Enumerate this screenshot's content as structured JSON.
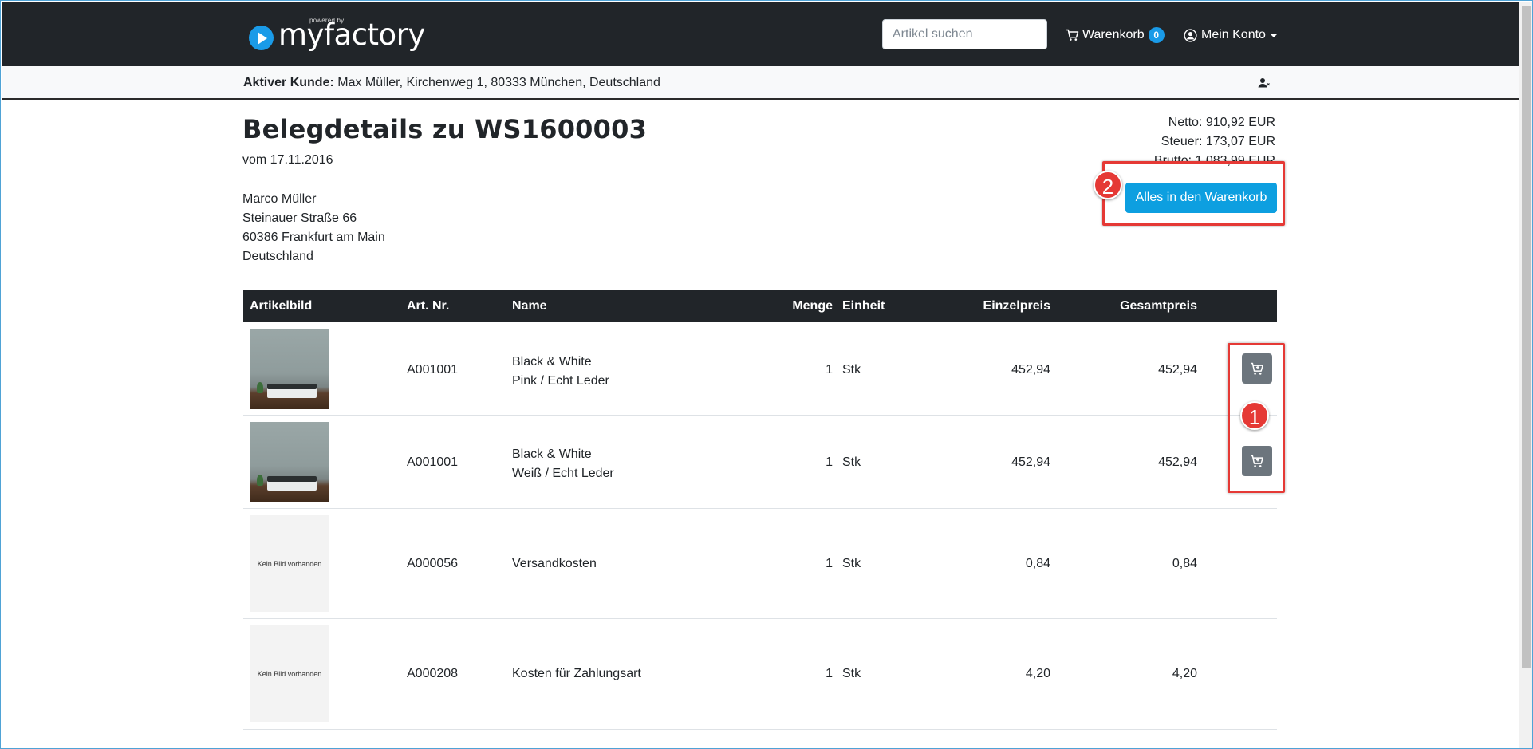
{
  "navbar": {
    "logo_powered": "powered by",
    "logo_text": "myfactory",
    "search_placeholder": "Artikel suchen",
    "cart_label": "Warenkorb",
    "cart_count": "0",
    "account_label": "Mein Konto"
  },
  "customer_bar": {
    "label": "Aktiver Kunde:",
    "value": "Max Müller, Kirchenweg 1, 80333 München, Deutschland"
  },
  "document": {
    "title": "Belegdetails zu WS1600003",
    "date": "vom 17.11.2016",
    "address": [
      "Marco Müller",
      "Steinauer Straße 66",
      "60386 Frankfurt am Main",
      "Deutschland"
    ],
    "netto": "Netto: 910,92 EUR",
    "steuer": "Steuer: 173,07 EUR",
    "brutto": "Brutto: 1.083,99 EUR",
    "add_all_label": "Alles in den Warenkorb"
  },
  "annotations": {
    "marker_1": "1",
    "marker_2": "2"
  },
  "table": {
    "headers": {
      "image": "Artikelbild",
      "art_nr": "Art. Nr.",
      "name": "Name",
      "qty": "Menge",
      "unit": "Einheit",
      "unit_price": "Einzelpreis",
      "total_price": "Gesamtpreis"
    },
    "no_image_text": "Kein Bild vorhanden",
    "rows": [
      {
        "art_nr": "A001001",
        "name_line1": "Black & White",
        "name_line2": "Pink / Echt Leder",
        "qty": "1",
        "unit": "Stk",
        "unit_price": "452,94",
        "total_price": "452,94"
      },
      {
        "art_nr": "A001001",
        "name_line1": "Black & White",
        "name_line2": "Weiß / Echt Leder",
        "qty": "1",
        "unit": "Stk",
        "unit_price": "452,94",
        "total_price": "452,94"
      },
      {
        "art_nr": "A000056",
        "name_line1": "Versandkosten",
        "name_line2": "",
        "qty": "1",
        "unit": "Stk",
        "unit_price": "0,84",
        "total_price": "0,84"
      },
      {
        "art_nr": "A000208",
        "name_line1": "Kosten für Zahlungsart",
        "name_line2": "",
        "qty": "1",
        "unit": "Stk",
        "unit_price": "4,20",
        "total_price": "4,20"
      }
    ]
  }
}
